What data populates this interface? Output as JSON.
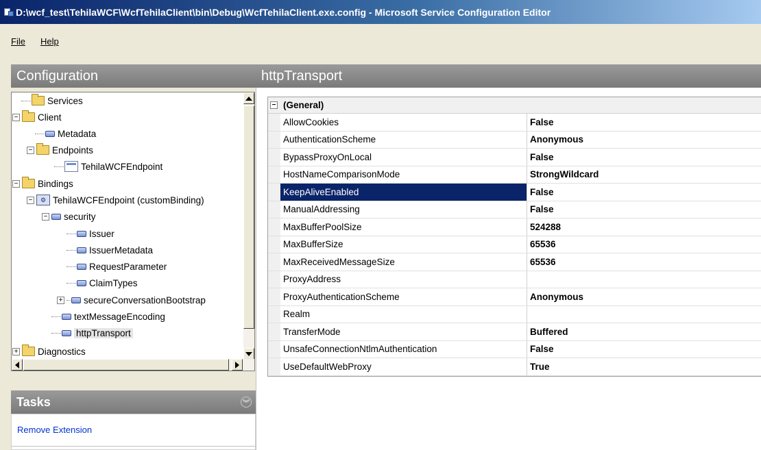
{
  "window": {
    "title": "D:\\wcf_test\\TehilaWCF\\WcfTehilaClient\\bin\\Debug\\WcfTehilaClient.exe.config - Microsoft Service Configuration Editor"
  },
  "menu": {
    "file": "File",
    "help": "Help"
  },
  "configuration": {
    "header": "Configuration",
    "tree": [
      {
        "label": "Services",
        "icon": "folder-icon"
      },
      {
        "label": "Client",
        "icon": "folder-icon"
      },
      {
        "label": "Metadata",
        "icon": "extension-icon"
      },
      {
        "label": "Endpoints",
        "icon": "folder-icon"
      },
      {
        "label": "TehilaWCFEndpoint",
        "icon": "endpoint-icon"
      },
      {
        "label": "Bindings",
        "icon": "folder-icon"
      },
      {
        "label": "TehilaWCFEndpoint (customBinding)",
        "icon": "binding-icon"
      },
      {
        "label": "security",
        "icon": "extension-icon"
      },
      {
        "label": "Issuer",
        "icon": "extension-icon"
      },
      {
        "label": "IssuerMetadata",
        "icon": "extension-icon"
      },
      {
        "label": "RequestParameter",
        "icon": "extension-icon"
      },
      {
        "label": "ClaimTypes",
        "icon": "extension-icon"
      },
      {
        "label": "secureConversationBootstrap",
        "icon": "extension-icon"
      },
      {
        "label": "textMessageEncoding",
        "icon": "extension-icon"
      },
      {
        "label": "httpTransport",
        "icon": "extension-icon",
        "selected": true
      },
      {
        "label": "Diagnostics",
        "icon": "folder-icon"
      }
    ]
  },
  "tasks": {
    "header": "Tasks",
    "items": [
      "Remove Extension"
    ]
  },
  "details": {
    "header": "httpTransport",
    "category": "(General)",
    "properties": [
      {
        "name": "AllowCookies",
        "value": "False"
      },
      {
        "name": "AuthenticationScheme",
        "value": "Anonymous"
      },
      {
        "name": "BypassProxyOnLocal",
        "value": "False"
      },
      {
        "name": "HostNameComparisonMode",
        "value": "StrongWildcard"
      },
      {
        "name": "KeepAliveEnabled",
        "value": "False",
        "selected": true
      },
      {
        "name": "ManualAddressing",
        "value": "False"
      },
      {
        "name": "MaxBufferPoolSize",
        "value": "524288"
      },
      {
        "name": "MaxBufferSize",
        "value": "65536"
      },
      {
        "name": "MaxReceivedMessageSize",
        "value": "65536"
      },
      {
        "name": "ProxyAddress",
        "value": ""
      },
      {
        "name": "ProxyAuthenticationScheme",
        "value": "Anonymous"
      },
      {
        "name": "Realm",
        "value": ""
      },
      {
        "name": "TransferMode",
        "value": "Buffered"
      },
      {
        "name": "UnsafeConnectionNtlmAuthentication",
        "value": "False"
      },
      {
        "name": "UseDefaultWebProxy",
        "value": "True"
      }
    ]
  }
}
